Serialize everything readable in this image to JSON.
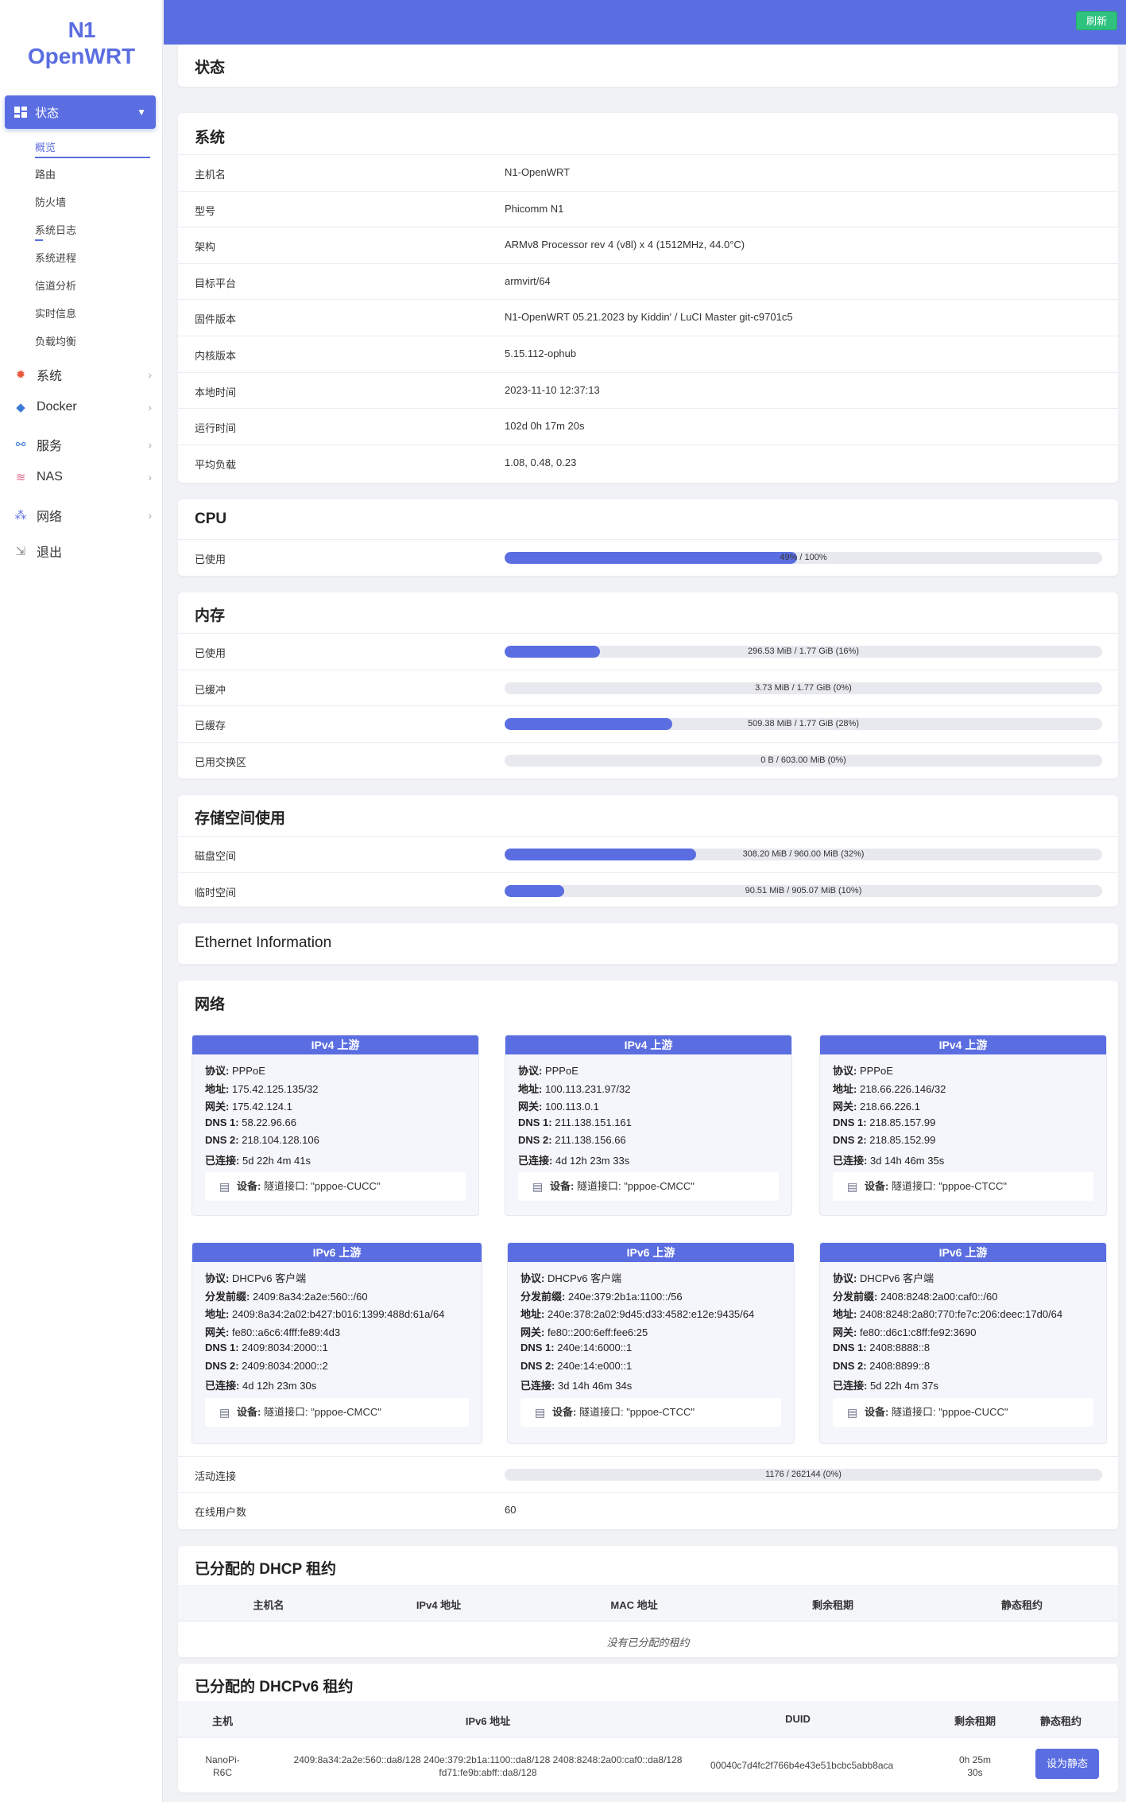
{
  "logo": {
    "line1": "N1",
    "line2": "OpenWRT"
  },
  "sidebar": {
    "active": {
      "icon": "dashboard-icon",
      "label": "状态"
    },
    "sub_items": [
      "概览",
      "路由",
      "防火墙",
      "系统日志",
      "系统进程",
      "信道分析",
      "实时信息",
      "负载均衡"
    ],
    "menus": [
      {
        "label": "系统",
        "icon": "gear-icon",
        "color": "#e8563b"
      },
      {
        "label": "Docker",
        "icon": "docker-icon",
        "color": "#3a7bd5"
      },
      {
        "label": "服务",
        "icon": "services-icon",
        "color": "#3a7bd5"
      },
      {
        "label": "NAS",
        "icon": "nas-icon",
        "color": "#e06c8a"
      },
      {
        "label": "网络",
        "icon": "network-icon",
        "color": "#5b6ee1"
      },
      {
        "label": "退出",
        "icon": "logout-icon",
        "color": "#888"
      }
    ]
  },
  "topbar": {
    "refresh": "刷新"
  },
  "page_title": "状态",
  "system": {
    "title": "系统",
    "rows": [
      {
        "k": "主机名",
        "v": "N1-OpenWRT"
      },
      {
        "k": "型号",
        "v": "Phicomm N1"
      },
      {
        "k": "架构",
        "v": "ARMv8 Processor rev 4 (v8l) x 4 (1512MHz, 44.0°C)"
      },
      {
        "k": "目标平台",
        "v": "armvirt/64"
      },
      {
        "k": "固件版本",
        "v": "N1-OpenWRT 05.21.2023 by Kiddin' / LuCI Master git-c9701c5"
      },
      {
        "k": "内核版本",
        "v": "5.15.112-ophub"
      },
      {
        "k": "本地时间",
        "v": "2023-11-10 12:37:13"
      },
      {
        "k": "运行时间",
        "v": "102d 0h 17m 20s"
      },
      {
        "k": "平均负载",
        "v": "1.08, 0.48, 0.23"
      }
    ]
  },
  "cpu": {
    "title": "CPU",
    "rows": [
      {
        "k": "已使用",
        "pct": 49,
        "text": "49% / 100%"
      }
    ]
  },
  "memory": {
    "title": "内存",
    "rows": [
      {
        "k": "已使用",
        "pct": 16,
        "text": "296.53 MiB / 1.77 GiB (16%)"
      },
      {
        "k": "已缓冲",
        "pct": 0,
        "text": "3.73 MiB / 1.77 GiB (0%)"
      },
      {
        "k": "已缓存",
        "pct": 28,
        "text": "509.38 MiB / 1.77 GiB (28%)"
      },
      {
        "k": "已用交换区",
        "pct": 0,
        "text": "0 B / 603.00 MiB (0%)"
      }
    ]
  },
  "storage": {
    "title": "存储空间使用",
    "rows": [
      {
        "k": "磁盘空间",
        "pct": 32,
        "text": "308.20 MiB / 960.00 MiB (32%)"
      },
      {
        "k": "临时空间",
        "pct": 10,
        "text": "90.51 MiB / 905.07 MiB (10%)"
      }
    ]
  },
  "ethernet": {
    "title": "Ethernet Information"
  },
  "network": {
    "title": "网络",
    "ipv4": [
      {
        "head": "IPv4 上游",
        "lines": [
          [
            "协议:",
            "PPPoE"
          ],
          [
            "地址:",
            "175.42.125.135/32"
          ],
          [
            "网关:",
            "175.42.124.1"
          ],
          [
            "DNS 1:",
            "58.22.96.66"
          ],
          [
            "DNS 2:",
            "218.104.128.106"
          ],
          [
            "已连接:",
            "5d 22h 4m 41s"
          ]
        ],
        "dev_label": "设备:",
        "dev": "隧道接口: \"pppoe-CUCC\""
      },
      {
        "head": "IPv4 上游",
        "lines": [
          [
            "协议:",
            "PPPoE"
          ],
          [
            "地址:",
            "100.113.231.97/32"
          ],
          [
            "网关:",
            "100.113.0.1"
          ],
          [
            "DNS 1:",
            "211.138.151.161"
          ],
          [
            "DNS 2:",
            "211.138.156.66"
          ],
          [
            "已连接:",
            "4d 12h 23m 33s"
          ]
        ],
        "dev_label": "设备:",
        "dev": "隧道接口: \"pppoe-CMCC\""
      },
      {
        "head": "IPv4 上游",
        "lines": [
          [
            "协议:",
            "PPPoE"
          ],
          [
            "地址:",
            "218.66.226.146/32"
          ],
          [
            "网关:",
            "218.66.226.1"
          ],
          [
            "DNS 1:",
            "218.85.157.99"
          ],
          [
            "DNS 2:",
            "218.85.152.99"
          ],
          [
            "已连接:",
            "3d 14h 46m 35s"
          ]
        ],
        "dev_label": "设备:",
        "dev": "隧道接口: \"pppoe-CTCC\""
      }
    ],
    "ipv6": [
      {
        "head": "IPv6 上游",
        "lines": [
          [
            "协议:",
            "DHCPv6 客户端"
          ],
          [
            "分发前缀:",
            "2409:8a34:2a2e:560::/60"
          ],
          [
            "地址:",
            "2409:8a34:2a02:b427:b016:1399:488d:61a/64"
          ],
          [
            "网关:",
            "fe80::a6c6:4fff:fe89:4d3"
          ],
          [
            "DNS 1:",
            "2409:8034:2000::1"
          ],
          [
            "DNS 2:",
            "2409:8034:2000::2"
          ],
          [
            "已连接:",
            "4d 12h 23m 30s"
          ]
        ],
        "dev_label": "设备:",
        "dev": "隧道接口: \"pppoe-CMCC\""
      },
      {
        "head": "IPv6 上游",
        "lines": [
          [
            "协议:",
            "DHCPv6 客户端"
          ],
          [
            "分发前缀:",
            "240e:379:2b1a:1100::/56"
          ],
          [
            "地址:",
            "240e:378:2a02:9d45:d33:4582:e12e:9435/64"
          ],
          [
            "网关:",
            "fe80::200:6eff:fee6:25"
          ],
          [
            "DNS 1:",
            "240e:14:6000::1"
          ],
          [
            "DNS 2:",
            "240e:14:e000::1"
          ],
          [
            "已连接:",
            "3d 14h 46m 34s"
          ]
        ],
        "dev_label": "设备:",
        "dev": "隧道接口: \"pppoe-CTCC\""
      },
      {
        "head": "IPv6 上游",
        "lines": [
          [
            "协议:",
            "DHCPv6 客户端"
          ],
          [
            "分发前缀:",
            "2408:8248:2a00:caf0::/60"
          ],
          [
            "地址:",
            "2408:8248:2a80:770:fe7c:206:deec:17d0/64"
          ],
          [
            "网关:",
            "fe80::d6c1:c8ff:fe92:3690"
          ],
          [
            "DNS 1:",
            "2408:8888::8"
          ],
          [
            "DNS 2:",
            "2408:8899::8"
          ],
          [
            "已连接:",
            "5d 22h 4m 37s"
          ]
        ],
        "dev_label": "设备:",
        "dev": "隧道接口: \"pppoe-CUCC\""
      }
    ],
    "conn": {
      "k": "活动连接",
      "pct": 0,
      "text": "1176 / 262144 (0%)"
    },
    "users": {
      "k": "在线用户数",
      "v": "60"
    }
  },
  "dhcp": {
    "title": "已分配的 DHCP 租约",
    "headers": [
      "主机名",
      "IPv4 地址",
      "MAC 地址",
      "剩余租期",
      "静态租约"
    ],
    "empty": "没有已分配的租约"
  },
  "dhcp6": {
    "title": "已分配的 DHCPv6 租约",
    "headers": [
      "主机",
      "IPv6 地址",
      "DUID",
      "剩余租期",
      "静态租约"
    ],
    "row": {
      "host1": "NanoPi-",
      "host2": "R6C",
      "ipv6_1": "2409:8a34:2a2e:560::da8/128 240e:379:2b1a:1100::da8/128 2408:8248:2a00:caf0::da8/128",
      "ipv6_2": "fd71:fe9b:abff::da8/128",
      "duid": "00040c7d4fc2f766b4e43e51bcbc5abb8aca",
      "lease1": "0h 25m",
      "lease2": "30s",
      "button": "设为静态"
    }
  }
}
